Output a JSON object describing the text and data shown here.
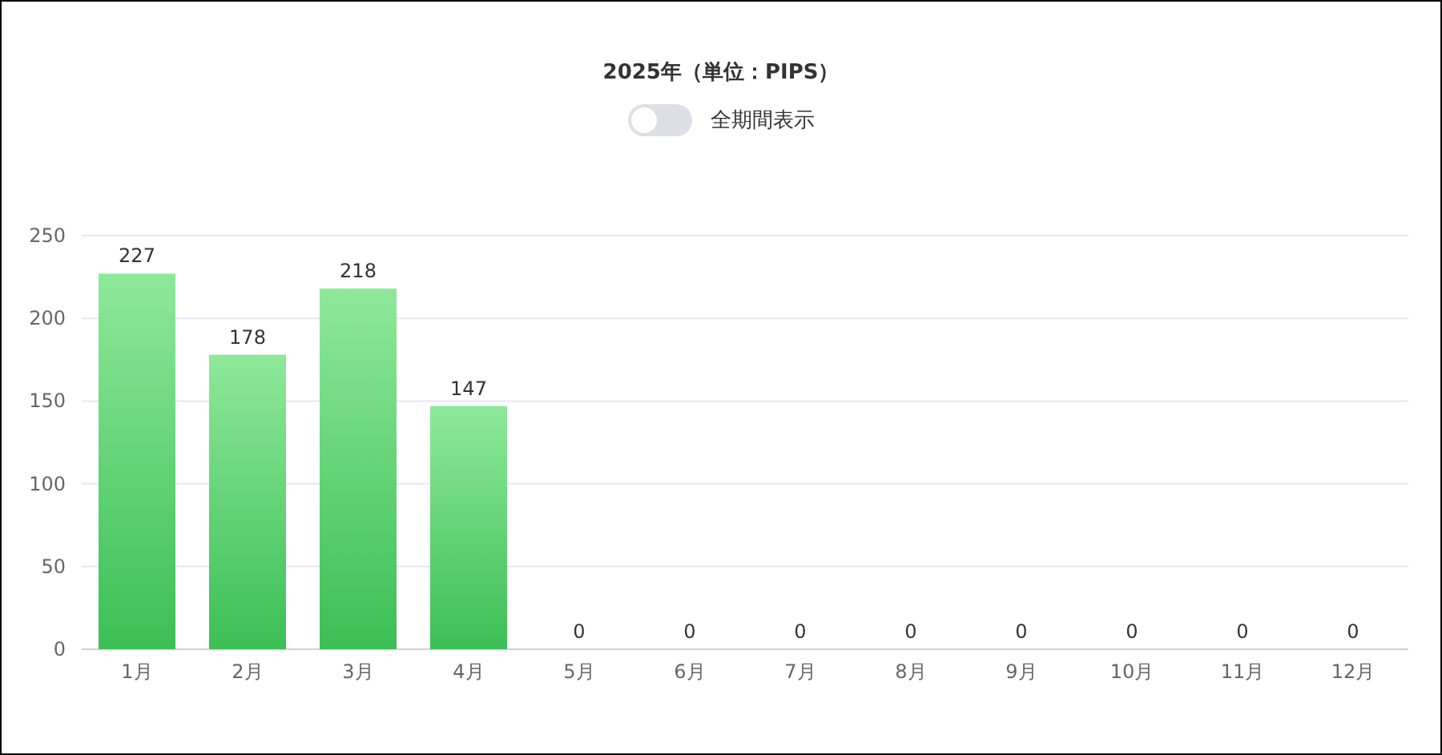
{
  "title": "2025年（単位：PIPS）",
  "toggle": {
    "label": "全期間表示",
    "on": false
  },
  "chart": {
    "chart_data": {
      "type": "bar",
      "categories": [
        "1月",
        "2月",
        "3月",
        "4月",
        "5月",
        "6月",
        "7月",
        "8月",
        "9月",
        "10月",
        "11月",
        "12月"
      ],
      "values": [
        227,
        178,
        218,
        147,
        0,
        0,
        0,
        0,
        0,
        0,
        0,
        0
      ],
      "ylim": [
        0,
        250
      ],
      "yticks": [
        0,
        50,
        100,
        150,
        200,
        250
      ],
      "data_labels": true,
      "grid": true
    }
  }
}
